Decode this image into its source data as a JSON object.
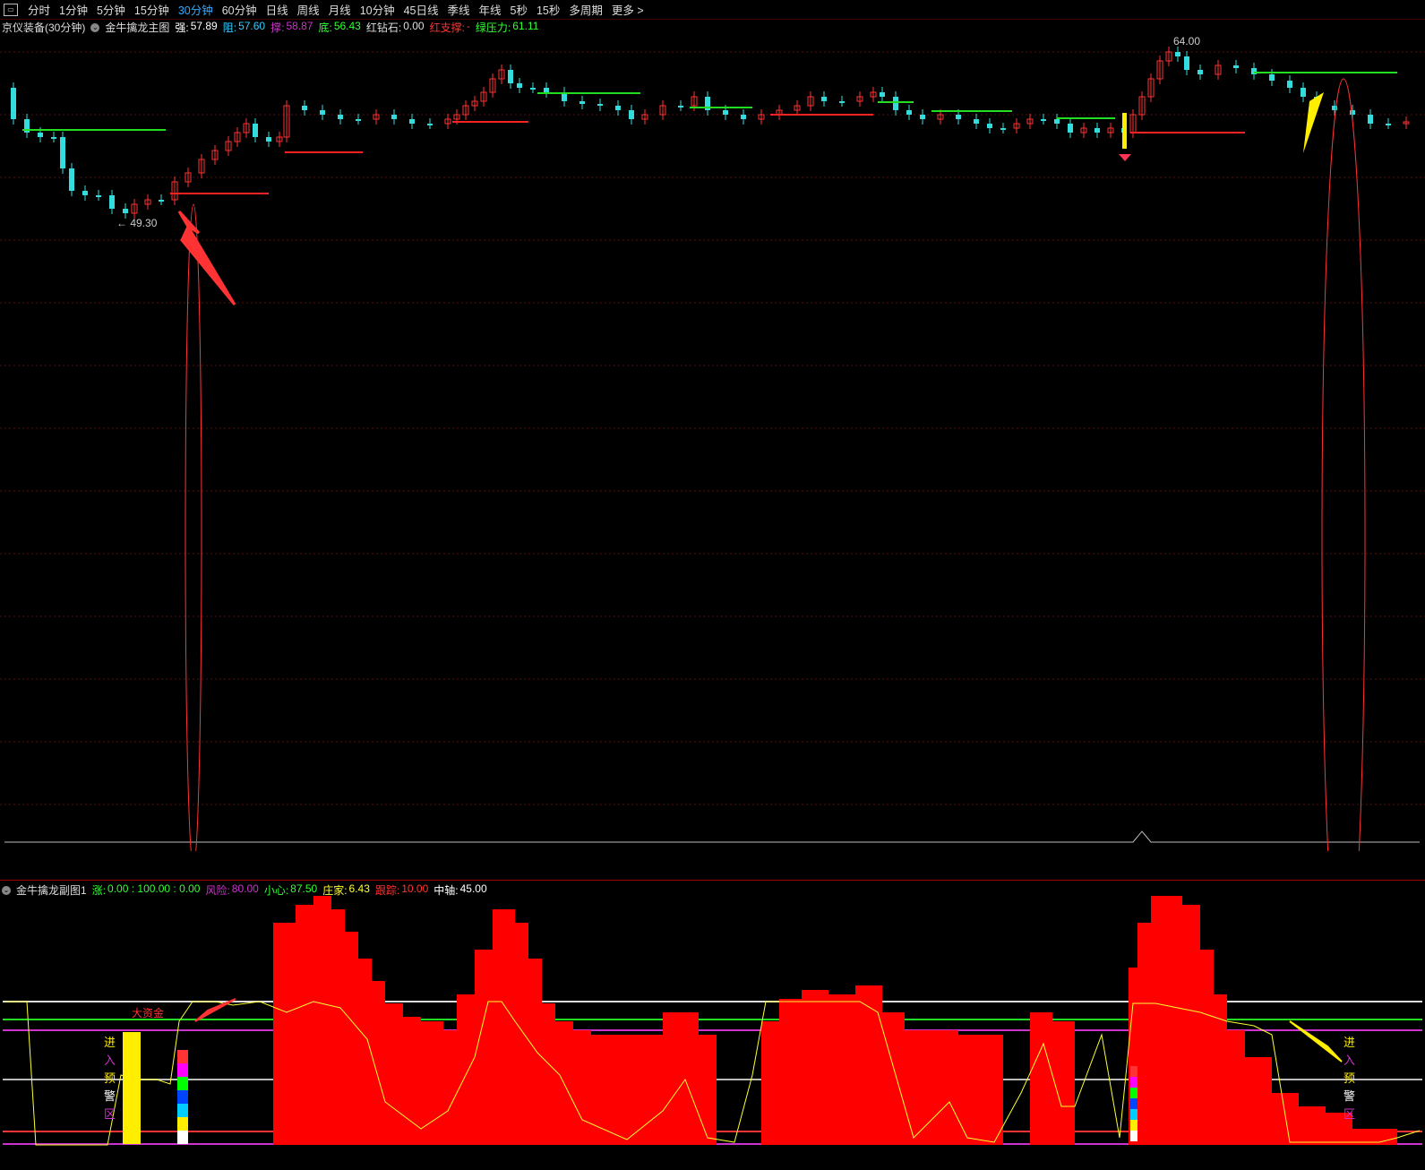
{
  "toolbar": {
    "icon": "window-icon",
    "tabs": [
      "分时",
      "1分钟",
      "5分钟",
      "15分钟",
      "30分钟",
      "60分钟",
      "日线",
      "周线",
      "月线",
      "10分钟",
      "45日线",
      "季线",
      "年线",
      "5秒",
      "15秒",
      "多周期",
      "更多 >"
    ],
    "active_index": 4
  },
  "main_info": {
    "stock": "京仪装备(30分钟)",
    "indicator": "金牛擒龙主图",
    "items": [
      {
        "label": "强:",
        "value": "57.89",
        "color": "#ffffff"
      },
      {
        "label": "阻:",
        "value": "57.60",
        "color": "#33ccff"
      },
      {
        "label": "撑:",
        "value": "58.87",
        "color": "#cc33cc"
      },
      {
        "label": "底:",
        "value": "56.43",
        "color": "#33ff33"
      },
      {
        "label": "红钻石:",
        "value": "0.00",
        "color": "#dddddd"
      },
      {
        "label": "红支撑:",
        "value": "-",
        "color": "#ff3333"
      },
      {
        "label": "绿压力:",
        "value": "61.11",
        "color": "#33ff33"
      }
    ]
  },
  "sub_info": {
    "indicator": "金牛擒龙副图1",
    "items": [
      {
        "label": "涨:",
        "value": "0.00 : 100.00 : 0.00",
        "color": "#33ff33"
      },
      {
        "label": "风险:",
        "value": "80.00",
        "color": "#cc33cc"
      },
      {
        "label": "小心:",
        "value": "87.50",
        "color": "#33ff33"
      },
      {
        "label": "庄家:",
        "value": "6.43",
        "color": "#ffff33"
      },
      {
        "label": "跟踪:",
        "value": "10.00",
        "color": "#ff3333"
      },
      {
        "label": "中轴:",
        "value": "45.00",
        "color": "#ffffff"
      }
    ]
  },
  "chart_labels": {
    "high": "64.00",
    "low": "49.30",
    "big_money": "大资金",
    "zone_left": [
      "进",
      "入",
      "预",
      "警",
      "区"
    ],
    "zone_right": [
      "进",
      "入",
      "预",
      "警",
      "区"
    ]
  },
  "chart_data": {
    "type": "candlestick",
    "price_range": [
      49.3,
      64.0
    ],
    "colors": {
      "up": "#ff3333",
      "down": "#33dddd",
      "support": "#ff2222",
      "resistance": "#22dd22",
      "bars": "#ff0000",
      "line": "#ffff33"
    }
  }
}
